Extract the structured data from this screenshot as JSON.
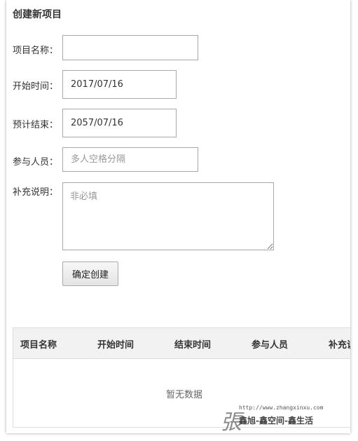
{
  "form": {
    "title": "创建新项目",
    "name_label": "项目名称：",
    "name_value": "",
    "start_label": "开始时间：",
    "start_value": "2017/07/16",
    "end_label": "预计结束：",
    "end_value": "2057/07/16",
    "members_label": "参与人员：",
    "members_placeholder": "多人空格分隔",
    "desc_label": "补充说明：",
    "desc_placeholder": "非必填",
    "submit_label": "确定创建"
  },
  "table": {
    "columns": [
      "项目名称",
      "开始时间",
      "结束时间",
      "参与人员",
      "补充说明"
    ],
    "empty_text": "暂无数据"
  },
  "watermark": {
    "glyph": "張",
    "url": "http://www.zhangxinxu.com",
    "slogan": "鑫旭-鑫空间-鑫生活"
  }
}
